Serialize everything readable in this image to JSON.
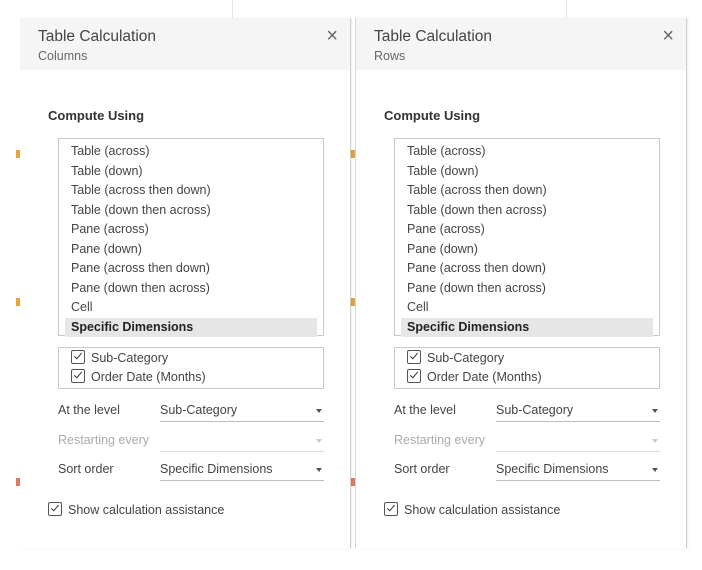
{
  "panels": [
    {
      "title": "Table Calculation",
      "subtitle": "Columns",
      "close_symbol": "×",
      "compute_label": "Compute Using",
      "options": [
        "Table (across)",
        "Table (down)",
        "Table (across then down)",
        "Table (down then across)",
        "Pane (across)",
        "Pane (down)",
        "Pane (across then down)",
        "Pane (down then across)",
        "Cell",
        "Specific Dimensions"
      ],
      "selected_option": "Specific Dimensions",
      "dimensions": [
        {
          "label": "Sub-Category",
          "checked": true
        },
        {
          "label": "Order Date (Months)",
          "checked": true
        }
      ],
      "at_level_label": "At the level",
      "at_level_value": "Sub-Category",
      "restarting_label": "Restarting every",
      "restarting_value": "",
      "sort_label": "Sort order",
      "sort_value": "Specific Dimensions",
      "assist_label": "Show calculation assistance",
      "assist_checked": true
    },
    {
      "title": "Table Calculation",
      "subtitle": "Rows",
      "close_symbol": "×",
      "compute_label": "Compute Using",
      "options": [
        "Table (across)",
        "Table (down)",
        "Table (across then down)",
        "Table (down then across)",
        "Pane (across)",
        "Pane (down)",
        "Pane (across then down)",
        "Pane (down then across)",
        "Cell",
        "Specific Dimensions"
      ],
      "selected_option": "Specific Dimensions",
      "dimensions": [
        {
          "label": "Sub-Category",
          "checked": true
        },
        {
          "label": "Order Date (Months)",
          "checked": true
        }
      ],
      "at_level_label": "At the level",
      "at_level_value": "Sub-Category",
      "restarting_label": "Restarting every",
      "restarting_value": "",
      "sort_label": "Sort order",
      "sort_value": "Specific Dimensions",
      "assist_label": "Show calculation assistance",
      "assist_checked": true
    }
  ],
  "colors": {
    "header_bg": "#f5f5f5",
    "selected_bg": "#e6e6e6",
    "border": "#c9c9c9",
    "chart_accent": "#e8a33a"
  }
}
